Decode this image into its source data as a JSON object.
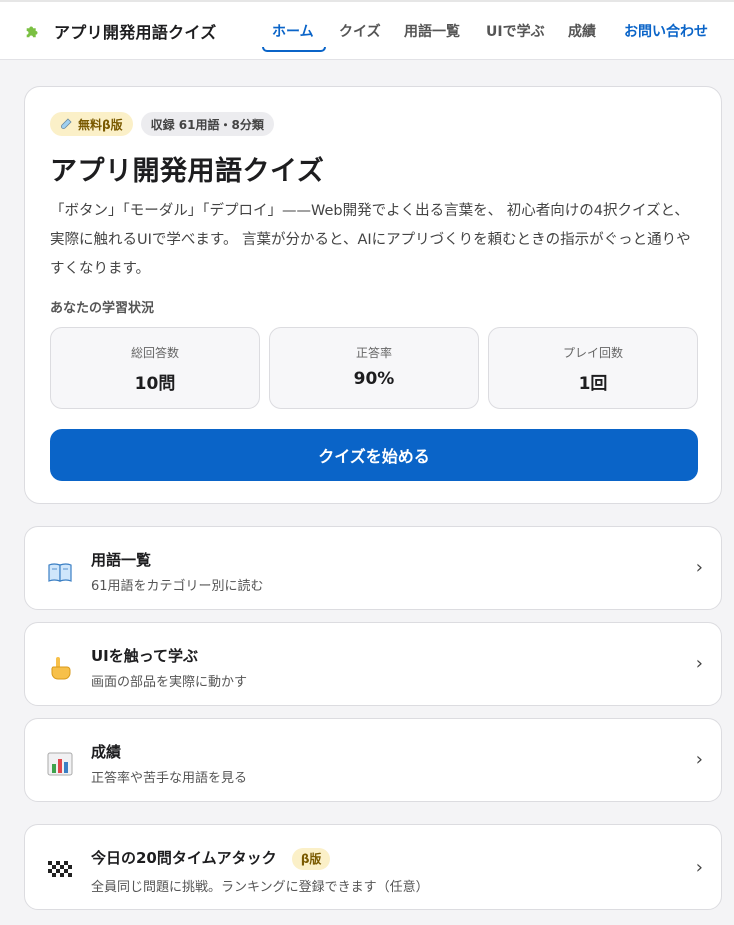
{
  "header": {
    "brand_title": "アプリ開発用語クイズ",
    "nav": {
      "home": "ホーム",
      "quiz": "クイズ",
      "glossary": "用語一覧",
      "ui_learn": "UIで学ぶ",
      "results": "成績",
      "contact": "お問い合わせ"
    },
    "active_nav": "home"
  },
  "hero": {
    "badge_beta": "無料β版",
    "badge_count": "収録 61用語・8分類",
    "title": "アプリ開発用語クイズ",
    "description": "「ボタン」「モーダル」「デプロイ」——Web開発でよく出る言葉を、 初心者向けの4択クイズと、実際に触れるUIで学べます。 言葉が分かると、AIにアプリづくりを頼むときの指示がぐっと通りやすくなります。",
    "status_label": "あなたの学習状況",
    "stats": [
      {
        "label": "総回答数",
        "value": "10問"
      },
      {
        "label": "正答率",
        "value": "90%"
      },
      {
        "label": "プレイ回数",
        "value": "1回"
      }
    ],
    "start_button": "クイズを始める"
  },
  "cards": [
    {
      "icon": "book-icon",
      "title": "用語一覧",
      "subtitle": "61用語をカテゴリー別に読む"
    },
    {
      "icon": "pointing-hand-icon",
      "title": "UIを触って学ぶ",
      "subtitle": "画面の部品を実際に動かす"
    },
    {
      "icon": "bar-chart-icon",
      "title": "成績",
      "subtitle": "正答率や苦手な用語を見る"
    },
    {
      "icon": "checkered-flag-icon",
      "title": "今日の20問タイムアタック",
      "badge": "β版",
      "subtitle": "全員同じ問題に挑戦。ランキングに登録できます（任意）"
    }
  ],
  "chevron": "›",
  "colors": {
    "accent": "#0a64c8",
    "beta_bg": "#fbf0c8",
    "beta_text": "#7a5a00"
  }
}
